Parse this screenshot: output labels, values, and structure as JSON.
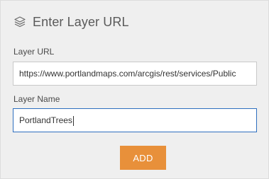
{
  "header": {
    "icon": "layers-icon",
    "title": "Enter Layer URL"
  },
  "layer_url": {
    "label": "Layer URL",
    "value": "https://www.portlandmaps.com/arcgis/rest/services/Public"
  },
  "layer_name": {
    "label": "Layer Name",
    "value": "PortlandTrees"
  },
  "add_button": {
    "label": "ADD"
  },
  "colors": {
    "panel_background": "#efefef",
    "accent": "#e8903a",
    "focus_border": "#2e6fbf"
  }
}
